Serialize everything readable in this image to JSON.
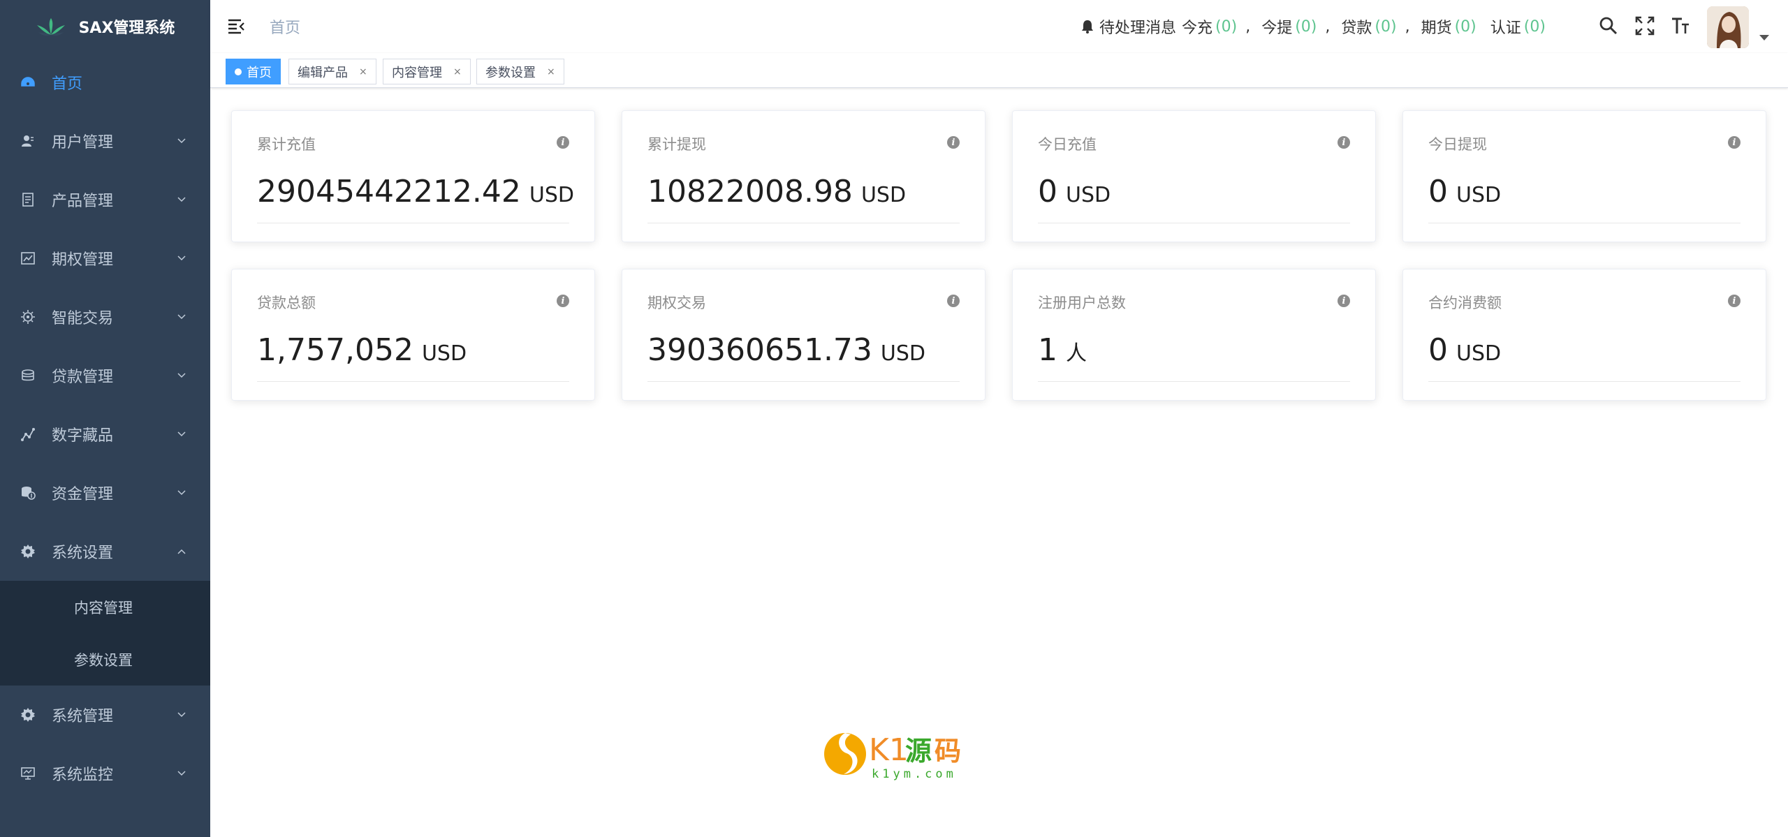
{
  "app": {
    "title": "SAX管理系统"
  },
  "sidebar": {
    "items": [
      {
        "label": "首页",
        "icon": "dashboard-icon"
      },
      {
        "label": "用户管理",
        "icon": "user-icon"
      },
      {
        "label": "产品管理",
        "icon": "document-icon"
      },
      {
        "label": "期权管理",
        "icon": "chart-icon"
      },
      {
        "label": "智能交易",
        "icon": "gear-icon"
      },
      {
        "label": "贷款管理",
        "icon": "money-icon"
      },
      {
        "label": "数字藏品",
        "icon": "graph-icon"
      },
      {
        "label": "资金管理",
        "icon": "fund-icon"
      },
      {
        "label": "系统设置",
        "icon": "settings-icon"
      },
      {
        "label": "系统管理",
        "icon": "settings-icon"
      },
      {
        "label": "系统监控",
        "icon": "monitor-icon"
      }
    ],
    "submenu": [
      "内容管理",
      "参数设置"
    ]
  },
  "header": {
    "breadcrumb": "首页",
    "notice": {
      "label": "待处理消息",
      "items": [
        {
          "label": "今充",
          "count": "(0)"
        },
        {
          "label": "今提",
          "count": "(0)"
        },
        {
          "label": "贷款",
          "count": "(0)"
        },
        {
          "label": "期货",
          "count": "(0)"
        },
        {
          "label": "认证",
          "count": "(0)"
        }
      ],
      "sep": ","
    }
  },
  "tags": [
    {
      "label": "首页",
      "active": true
    },
    {
      "label": "编辑产品",
      "close": "×"
    },
    {
      "label": "内容管理",
      "close": "×"
    },
    {
      "label": "参数设置",
      "close": "×"
    }
  ],
  "cards": [
    {
      "title": "累计充值",
      "value": "29045442212.42",
      "unit": "USD"
    },
    {
      "title": "累计提现",
      "value": "10822008.98",
      "unit": "USD"
    },
    {
      "title": "今日充值",
      "value": "0",
      "unit": "USD"
    },
    {
      "title": "今日提现",
      "value": "0",
      "unit": "USD"
    },
    {
      "title": "贷款总额",
      "value": "1,757,052",
      "unit": "USD"
    },
    {
      "title": "期权交易",
      "value": "390360651.73",
      "unit": "USD"
    },
    {
      "title": "注册用户总数",
      "value": "1",
      "unit": "人"
    },
    {
      "title": "合约消费额",
      "value": "0",
      "unit": "USD"
    }
  ],
  "info_glyph": "i",
  "watermark": {
    "brand": "K1源码",
    "url": "k1ym.com"
  },
  "colors": {
    "sidebar": "#304156",
    "active": "#409eff",
    "count": "#5ec48f"
  }
}
